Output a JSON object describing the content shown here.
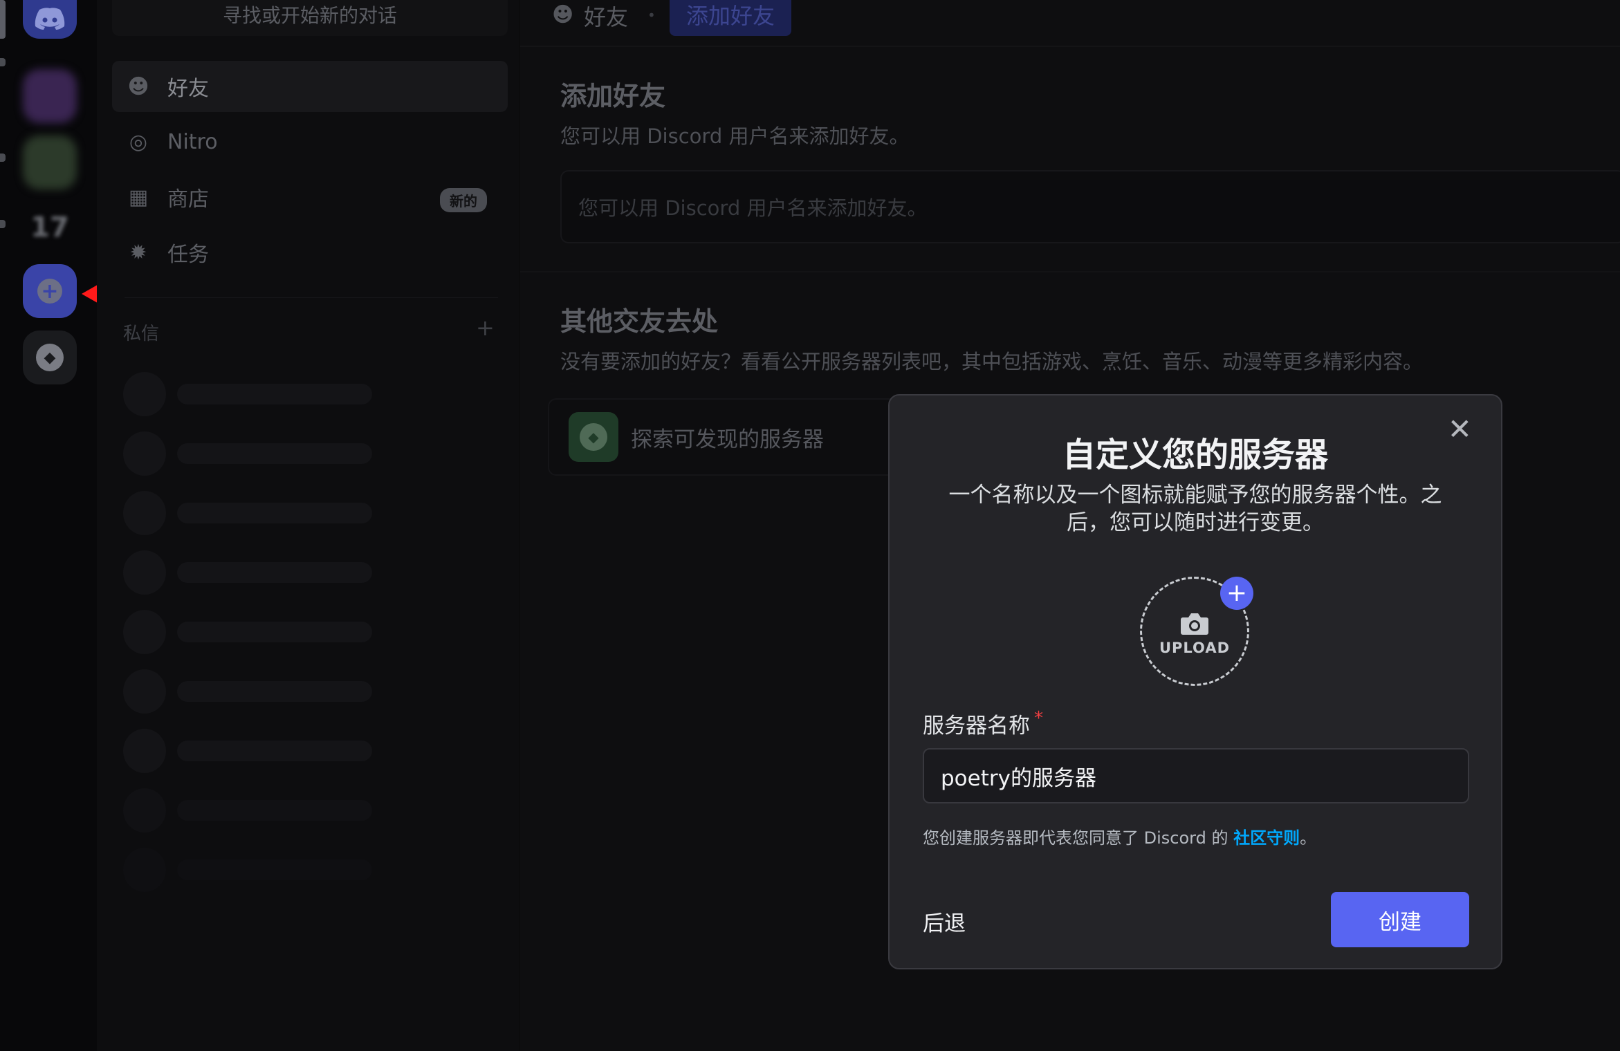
{
  "rail": {
    "discord_icon": "discord-logo-icon",
    "blurred_server_text": "17",
    "add_server_icon": "plus-circle-icon",
    "explore_icon": "compass-icon",
    "annotation_arrow_color": "#ff1a1a"
  },
  "dm": {
    "search_placeholder": "寻找或开始新的对话",
    "nav": [
      {
        "label": "好友",
        "icon": "friends-icon"
      },
      {
        "label": "Nitro",
        "icon": "nitro-icon"
      },
      {
        "label": "商店",
        "icon": "shop-icon",
        "badge": "新的"
      },
      {
        "label": "任务",
        "icon": "quests-icon"
      }
    ],
    "direct_messages_header": "私信",
    "add_dm_icon": "+"
  },
  "topbar": {
    "friends_label": "好友",
    "add_friend_tab": "添加好友"
  },
  "add_friend": {
    "title": "添加好友",
    "description": "您可以用 Discord 用户名来添加好友。",
    "input_placeholder": "您可以用 Discord 用户名来添加好友。"
  },
  "other_places": {
    "title": "其他交友去处",
    "description": "没有要添加的好友？看看公开服务器列表吧，其中包括游戏、烹饪、音乐、动漫等更多精彩内容。",
    "explore_label": "探索可发现的服务器"
  },
  "modal": {
    "title": "自定义您的服务器",
    "subtitle": "一个名称以及一个图标就能赋予您的服务器个性。之后，您可以随时进行变更。",
    "upload_label": "UPLOAD",
    "field_label": "服务器名称",
    "required_mark": "*",
    "field_value": "poetry的服务器",
    "terms_prefix": "您创建服务器即代表您同意了 Discord 的 ",
    "terms_link": "社区守则",
    "terms_suffix": "。",
    "back_label": "后退",
    "create_label": "创建",
    "accent_color": "#5865f2",
    "link_color": "#00a8fc"
  }
}
